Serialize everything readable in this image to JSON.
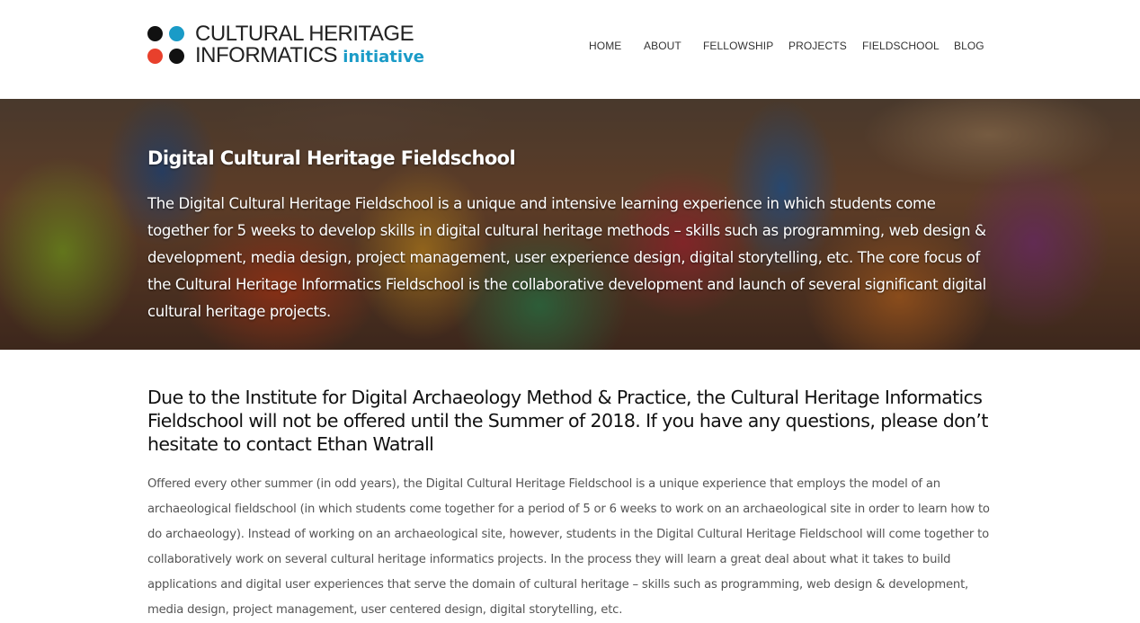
{
  "logo": {
    "line1": "CULTURAL HERITAGE",
    "line2_main": "INFORMATICS ",
    "line2_accent": "initiative",
    "dot_colors": [
      "#111111",
      "#1a9bc7",
      "#e8402c",
      "#111111"
    ],
    "accent_color": "#1a9bc7"
  },
  "nav": {
    "items": [
      {
        "label": "HOME"
      },
      {
        "label": "ABOUT"
      },
      {
        "label": "FELLOWSHIP"
      },
      {
        "label": "PROJECTS"
      },
      {
        "label": "FIELDSCHOOL"
      },
      {
        "label": "BLOG"
      }
    ]
  },
  "hero": {
    "title": "Digital Cultural Heritage Fieldschool",
    "text": "The Digital Cultural Heritage Fieldschool is a unique and intensive learning experience in which students come together for 5 weeks to develop skills in digital cultural heritage methods – skills such as programming, web design & development, media design, project management, user experience design, digital storytelling, etc. The core focus of the Cultural Heritage Informatics Fieldschool is the collaborative development and launch of several significant digital cultural heritage projects."
  },
  "main": {
    "heading": "Due to the Institute for Digital Archaeology Method & Practice, the Cultural Heritage Informatics Fieldschool will not be offered until the Summer of 2018.  If you have any questions, please don’t hesitate to contact Ethan Watrall",
    "paragraph": "Offered every other summer (in odd years), the Digital Cultural Heritage Fieldschool is a unique experience that employs the model of an archaeological fieldschool (in which students come together for a period of 5 or 6 weeks to work on an archaeological site in order to learn how to do archaeology).  Instead of working on an archaeological site, however, students in the Digital Cultural Heritage Fieldschool will come together to collaboratively work on several cultural heritage informatics projects.  In the process they will learn a great deal about what it takes to build applications and digital user experiences that serve the domain of cultural heritage – skills such as programming, web design & development, media design, project management, user centered design, digital storytelling, etc."
  }
}
